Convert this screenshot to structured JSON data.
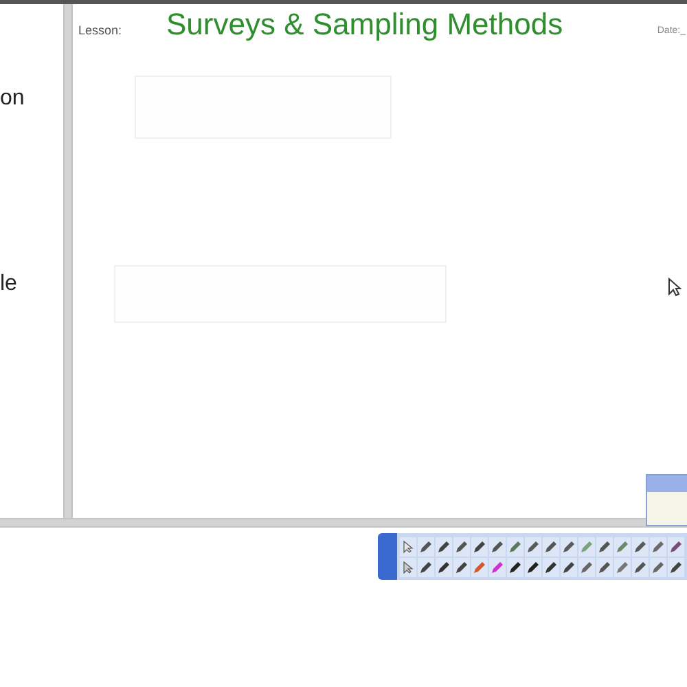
{
  "sidebar": {
    "texts": [
      "on",
      "le"
    ]
  },
  "page": {
    "label": "Lesson:",
    "title": "Surveys & Sampling Methods",
    "date_label": "Date:_"
  },
  "toolbar": {
    "rows": [
      [
        {
          "kind": "select",
          "color": "#e8e8e8"
        },
        {
          "kind": "pen",
          "color": "#555555"
        },
        {
          "kind": "pen",
          "color": "#444444"
        },
        {
          "kind": "pen",
          "color": "#555555"
        },
        {
          "kind": "pen",
          "color": "#444444"
        },
        {
          "kind": "pen",
          "color": "#555555"
        },
        {
          "kind": "pen",
          "color": "#5a7a5a"
        },
        {
          "kind": "pen",
          "color": "#5a5a5a"
        },
        {
          "kind": "pen",
          "color": "#555555"
        },
        {
          "kind": "pen",
          "color": "#5a5a5a"
        },
        {
          "kind": "pen",
          "color": "#7aa37a"
        },
        {
          "kind": "pen",
          "color": "#555555"
        },
        {
          "kind": "pen",
          "color": "#6b8a6b"
        },
        {
          "kind": "pen",
          "color": "#5a5a5a"
        },
        {
          "kind": "pen",
          "color": "#6b6b6b"
        },
        {
          "kind": "pen",
          "color": "#7a4a7a"
        }
      ],
      [
        {
          "kind": "select",
          "color": "#cccccc"
        },
        {
          "kind": "pen",
          "color": "#444444"
        },
        {
          "kind": "pen",
          "color": "#333333"
        },
        {
          "kind": "pen",
          "color": "#444444"
        },
        {
          "kind": "pen",
          "color": "#d05a2a"
        },
        {
          "kind": "pen",
          "color": "#d030d0"
        },
        {
          "kind": "pen",
          "color": "#222222"
        },
        {
          "kind": "pen",
          "color": "#222222"
        },
        {
          "kind": "pen",
          "color": "#333333"
        },
        {
          "kind": "pen",
          "color": "#444444"
        },
        {
          "kind": "pen",
          "color": "#666666"
        },
        {
          "kind": "pen",
          "color": "#555555"
        },
        {
          "kind": "pen",
          "color": "#777777"
        },
        {
          "kind": "pen",
          "color": "#555555"
        },
        {
          "kind": "pen",
          "color": "#666666"
        },
        {
          "kind": "pen",
          "color": "#444444"
        }
      ]
    ]
  }
}
